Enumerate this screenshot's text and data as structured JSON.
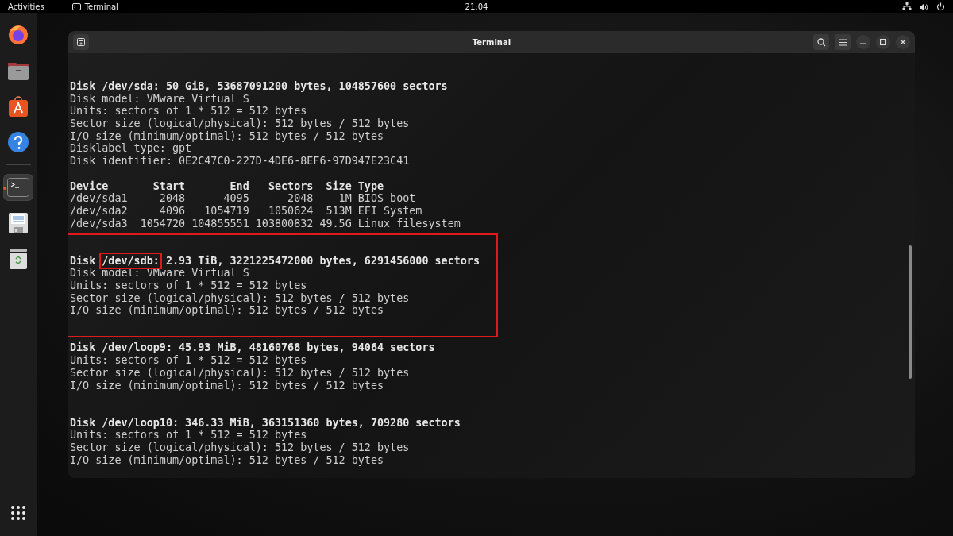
{
  "top_bar": {
    "activities": "Activities",
    "app_menu": "Terminal",
    "clock": "21:04"
  },
  "dock": {
    "items": [
      {
        "kind": "firefox",
        "active": false
      },
      {
        "kind": "files",
        "active": false
      },
      {
        "kind": "app-center",
        "active": false
      },
      {
        "kind": "help",
        "active": false
      },
      {
        "kind": "separator"
      },
      {
        "kind": "terminal",
        "active": true
      },
      {
        "kind": "document",
        "active": false
      },
      {
        "kind": "trash",
        "active": false
      }
    ]
  },
  "window": {
    "title": "Terminal",
    "output": [
      {
        "kind": "disk",
        "highlighted": false,
        "lines": [
          {
            "kind": "heading",
            "parts": [
              {
                "text": "Disk /dev/sda: 50 GiB, 53687091200 bytes, 104857600 sectors",
                "boxed": false
              }
            ]
          },
          {
            "kind": "plain",
            "parts": [
              {
                "text": "Disk model: VMware Virtual S",
                "boxed": false
              }
            ]
          },
          {
            "kind": "plain",
            "parts": [
              {
                "text": "Units: sectors of 1 * 512 = 512 bytes",
                "boxed": false
              }
            ]
          },
          {
            "kind": "plain",
            "parts": [
              {
                "text": "Sector size (logical/physical): 512 bytes / 512 bytes",
                "boxed": false
              }
            ]
          },
          {
            "kind": "plain",
            "parts": [
              {
                "text": "I/O size (minimum/optimal): 512 bytes / 512 bytes",
                "boxed": false
              }
            ]
          },
          {
            "kind": "plain",
            "parts": [
              {
                "text": "Disklabel type: gpt",
                "boxed": false
              }
            ]
          },
          {
            "kind": "plain",
            "parts": [
              {
                "text": "Disk identifier: 0E2C47C0-227D-4DE6-8EF6-97D947E23C41",
                "boxed": false
              }
            ]
          }
        ]
      },
      {
        "kind": "table",
        "highlighted": false,
        "lines": [
          {
            "kind": "heading",
            "parts": [
              {
                "text": "Device       Start       End   Sectors  Size Type",
                "boxed": false
              }
            ]
          },
          {
            "kind": "plain",
            "parts": [
              {
                "text": "/dev/sda1     2048      4095      2048    1M BIOS boot",
                "boxed": false
              }
            ]
          },
          {
            "kind": "plain",
            "parts": [
              {
                "text": "/dev/sda2     4096   1054719   1050624  513M EFI System",
                "boxed": false
              }
            ]
          },
          {
            "kind": "plain",
            "parts": [
              {
                "text": "/dev/sda3  1054720 104855551 103800832 49.5G Linux filesystem",
                "boxed": false
              }
            ]
          }
        ]
      },
      {
        "kind": "disk",
        "highlighted": true,
        "lines": [
          {
            "kind": "heading",
            "parts": [
              {
                "text": "Disk ",
                "boxed": false
              },
              {
                "text": "/dev/sdb:",
                "boxed": true
              },
              {
                "text": " 2.93 TiB, 3221225472000 bytes, 6291456000 sectors",
                "boxed": false
              }
            ]
          },
          {
            "kind": "plain",
            "parts": [
              {
                "text": "Disk model: VMware Virtual S",
                "boxed": false
              }
            ]
          },
          {
            "kind": "plain",
            "parts": [
              {
                "text": "Units: sectors of 1 * 512 = 512 bytes",
                "boxed": false
              }
            ]
          },
          {
            "kind": "plain",
            "parts": [
              {
                "text": "Sector size (logical/physical): 512 bytes / 512 bytes",
                "boxed": false
              }
            ]
          },
          {
            "kind": "plain",
            "parts": [
              {
                "text": "I/O size (minimum/optimal): 512 bytes / 512 bytes",
                "boxed": false
              }
            ]
          }
        ]
      },
      {
        "kind": "disk",
        "highlighted": false,
        "lines": [
          {
            "kind": "heading",
            "parts": [
              {
                "text": "Disk /dev/loop9: 45.93 MiB, 48160768 bytes, 94064 sectors",
                "boxed": false
              }
            ]
          },
          {
            "kind": "plain",
            "parts": [
              {
                "text": "Units: sectors of 1 * 512 = 512 bytes",
                "boxed": false
              }
            ]
          },
          {
            "kind": "plain",
            "parts": [
              {
                "text": "Sector size (logical/physical): 512 bytes / 512 bytes",
                "boxed": false
              }
            ]
          },
          {
            "kind": "plain",
            "parts": [
              {
                "text": "I/O size (minimum/optimal): 512 bytes / 512 bytes",
                "boxed": false
              }
            ]
          }
        ]
      },
      {
        "kind": "disk",
        "highlighted": false,
        "lines": [
          {
            "kind": "heading",
            "parts": [
              {
                "text": "Disk /dev/loop10: 346.33 MiB, 363151360 bytes, 709280 sectors",
                "boxed": false
              }
            ]
          },
          {
            "kind": "plain",
            "parts": [
              {
                "text": "Units: sectors of 1 * 512 = 512 bytes",
                "boxed": false
              }
            ]
          },
          {
            "kind": "plain",
            "parts": [
              {
                "text": "Sector size (logical/physical): 512 bytes / 512 bytes",
                "boxed": false
              }
            ]
          },
          {
            "kind": "plain",
            "parts": [
              {
                "text": "I/O size (minimum/optimal): 512 bytes / 512 bytes",
                "boxed": false
              }
            ]
          }
        ]
      }
    ]
  }
}
